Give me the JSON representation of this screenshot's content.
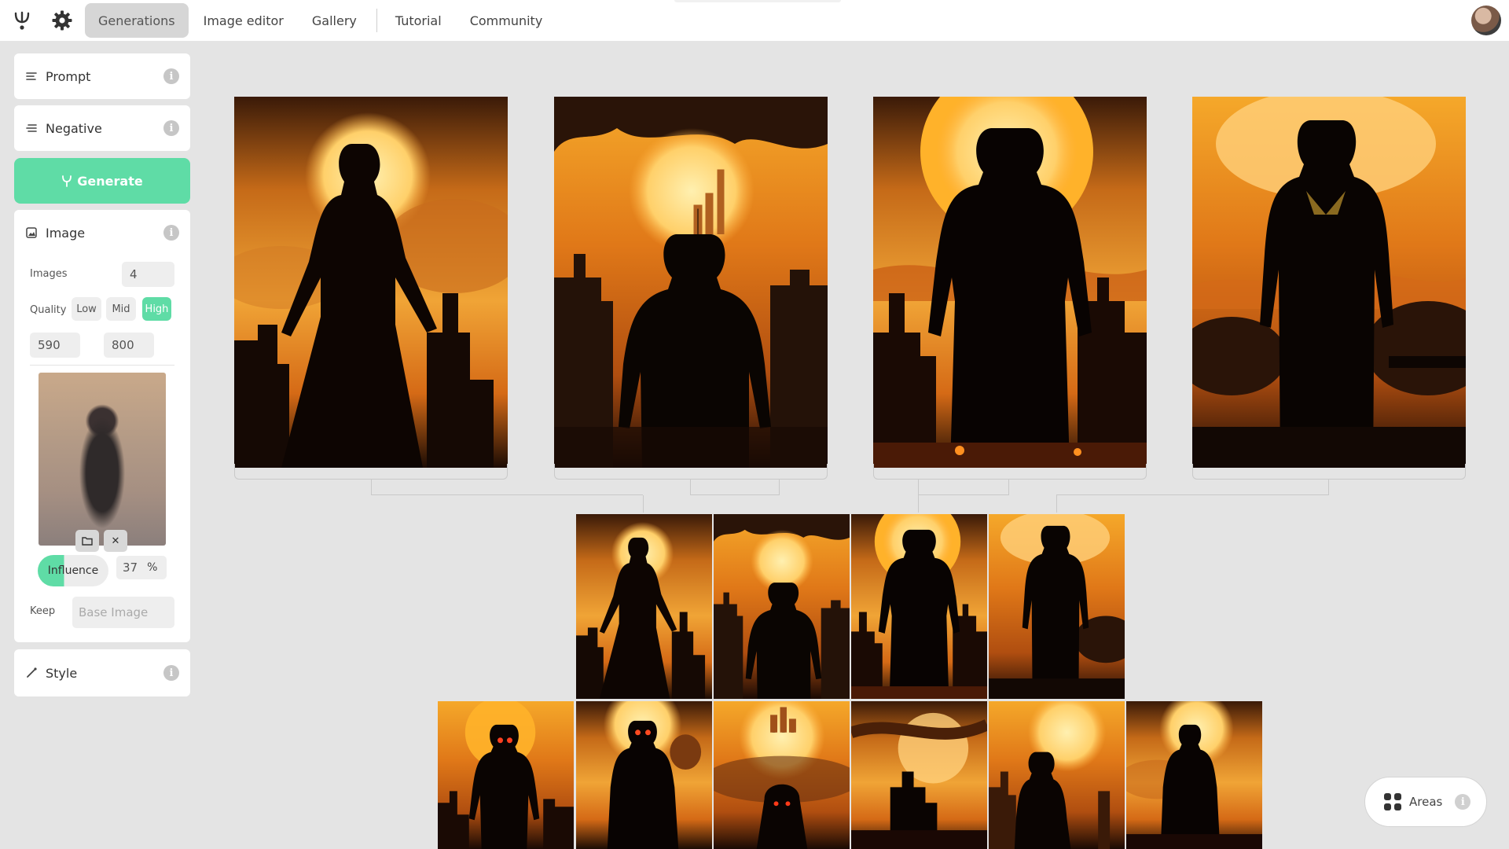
{
  "nav": {
    "items": [
      "Generations",
      "Image editor",
      "Gallery",
      "Tutorial",
      "Community"
    ],
    "active": "Generations"
  },
  "sidebar": {
    "prompt_label": "Prompt",
    "negative_label": "Negative",
    "generate_label": "Generate",
    "image_label": "Image",
    "images_label": "Images",
    "images_count": "4",
    "quality_label": "Quality",
    "quality_options": [
      "Low",
      "Mid",
      "High"
    ],
    "quality_selected": "High",
    "width": "590",
    "height": "800",
    "influence_label": "Influence",
    "influence_value": "37",
    "influence_unit": "%",
    "keep_label": "Keep",
    "keep_placeholder": "Base Image",
    "style_label": "Style"
  },
  "areas": {
    "label": "Areas"
  },
  "colors": {
    "accent": "#5fdca6",
    "background": "#e4e4e4"
  }
}
